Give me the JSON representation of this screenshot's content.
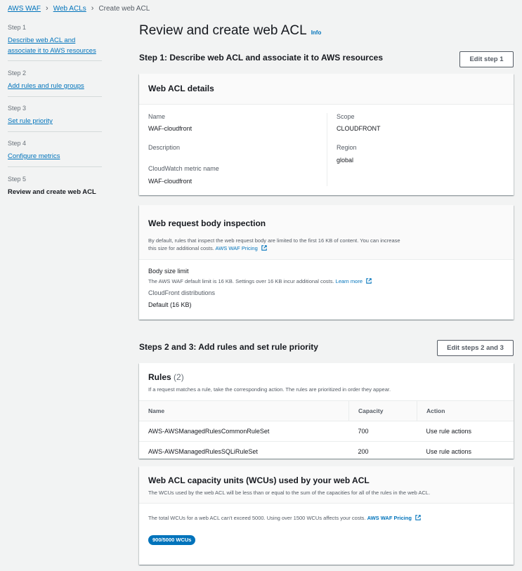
{
  "breadcrumb": {
    "items": [
      "AWS WAF",
      "Web ACLs"
    ],
    "current": "Create web ACL"
  },
  "steps": [
    {
      "num": "Step 1",
      "label": "Describe web ACL and associate it to AWS resources"
    },
    {
      "num": "Step 2",
      "label": "Add rules and rule groups"
    },
    {
      "num": "Step 3",
      "label": "Set rule priority"
    },
    {
      "num": "Step 4",
      "label": "Configure metrics"
    },
    {
      "num": "Step 5",
      "label": "Review and create web ACL"
    }
  ],
  "page": {
    "title": "Review and create web ACL",
    "info": "Info"
  },
  "step1": {
    "heading": "Step 1: Describe web ACL and associate it to AWS resources",
    "edit_label": "Edit step 1"
  },
  "details": {
    "title": "Web ACL details",
    "name_key": "Name",
    "name_val": "WAF-cloudfront",
    "description_key": "Description",
    "metric_key": "CloudWatch metric name",
    "metric_val": "WAF-cloudfront",
    "scope_key": "Scope",
    "scope_val": "CLOUDFRONT",
    "region_key": "Region",
    "region_val": "global"
  },
  "body_inspection": {
    "title": "Web request body inspection",
    "desc_line1": "By default, rules that inspect the web request body are limited to the first 16 KB of content. You can increase",
    "desc_line2": "this size for additional costs.",
    "pricing_link": "AWS WAF Pricing",
    "size_key": "Body size limit",
    "size_desc": "The AWS WAF default limit is 16 KB. Settings over 16 KB incur additional costs.",
    "learn_more": "Learn more",
    "cf_key": "CloudFront distributions",
    "cf_val": "Default (16 KB)"
  },
  "step23": {
    "heading": "Steps 2 and 3: Add rules and set rule priority",
    "edit_label": "Edit steps 2 and 3"
  },
  "rules": {
    "title": "Rules",
    "count": "(2)",
    "desc": "If a request matches a rule, take the corresponding action. The rules are prioritized in order they appear.",
    "columns": [
      "Name",
      "Capacity",
      "Action"
    ],
    "rows": [
      {
        "name": "AWS-AWSManagedRulesCommonRuleSet",
        "capacity": "700",
        "action": "Use rule actions"
      },
      {
        "name": "AWS-AWSManagedRulesSQLiRuleSet",
        "capacity": "200",
        "action": "Use rule actions"
      }
    ]
  },
  "wcu": {
    "title": "Web ACL capacity units (WCUs) used by your web ACL",
    "desc": "The WCUs used by the web ACL will be less than or equal to the sum of the capacities for all of the rules in the web ACL.",
    "note": "The total WCUs for a web ACL can't exceed 5000. Using over 1500 WCUs affects your costs.",
    "pricing_link": "AWS WAF Pricing",
    "badge": "900/5000 WCUs",
    "used": 900,
    "max": 5000
  },
  "colors": {
    "link": "#0073bb",
    "background": "#f2f3f3",
    "badge": "#0073bb"
  },
  "icons": [
    "external-link-icon",
    "chevron-right-icon"
  ]
}
